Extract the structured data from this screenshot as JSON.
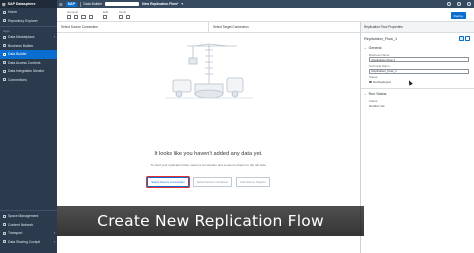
{
  "app": {
    "product": "SAP Datasphere",
    "logo": "SAP",
    "breadcrumb": "Data Builder",
    "flow_title": "New Replication Flow*"
  },
  "left_nav": {
    "top_items": [
      {
        "label": "Home",
        "icon": "home-icon"
      },
      {
        "label": "Repository Explorer",
        "icon": "folder-icon"
      }
    ],
    "section": "Apps",
    "items": [
      {
        "label": "Data Marketplace",
        "icon": "market-icon",
        "has_arrow": true
      },
      {
        "label": "Business Builder",
        "icon": "briefcase-icon"
      },
      {
        "label": "Data Builder",
        "icon": "builder-icon",
        "active": true
      },
      {
        "label": "Data Access Controls",
        "icon": "lock-icon"
      },
      {
        "label": "Data Integration Monitor",
        "icon": "monitor-icon"
      },
      {
        "label": "Connections",
        "icon": "connection-icon"
      }
    ],
    "bottom_items": [
      {
        "label": "Space Management",
        "icon": "space-icon"
      },
      {
        "label": "Content Network",
        "icon": "network-icon"
      },
      {
        "label": "Transport",
        "icon": "transport-icon"
      },
      {
        "label": "Data Sharing Cockpit",
        "icon": "sharing-icon"
      }
    ]
  },
  "toolbar": {
    "groups": [
      {
        "label": "General",
        "icons": [
          "save-icon",
          "deploy-icon",
          "undo-icon",
          "redo-icon"
        ]
      },
      {
        "label": "Edit",
        "icons": [
          "edit-icon"
        ]
      },
      {
        "label": "Tools",
        "icons": [
          "tools-icon",
          "settings-icon"
        ]
      }
    ],
    "deploy_label": "Deploy"
  },
  "canvas": {
    "source_header": "Select Source Connection",
    "target_header": "Select Target Connection",
    "empty_title": "It looks like you haven't added any data yet.",
    "empty_subtitle": "To start your replication flow, select a connection and a source object on the left side.",
    "buttons": {
      "select_source_connection": "Select Source Connection",
      "select_source_container": "Select Source Container",
      "add_source_objects": "Add Source Objects"
    }
  },
  "properties": {
    "header": "Replication Flow Properties",
    "flow_name": "Replication_Flow_1",
    "general_section": "General",
    "business_name_label": "Business Name:",
    "business_name_value": "Replication Flow 1",
    "technical_name_label": "Technical Name:",
    "technical_name_value": "Replication_Flow_1",
    "status_label": "Status:",
    "status_value": "Not Deployed",
    "run_status_section": "Run Status",
    "run_status_label": "Status:",
    "run_status_value": "Not Run Yet"
  },
  "caption": "Create New Replication Flow",
  "colors": {
    "nav_bg": "#2b3a4d",
    "shell_bg": "#354a5f",
    "accent": "#0a6ed1",
    "highlight": "#e4312e"
  }
}
